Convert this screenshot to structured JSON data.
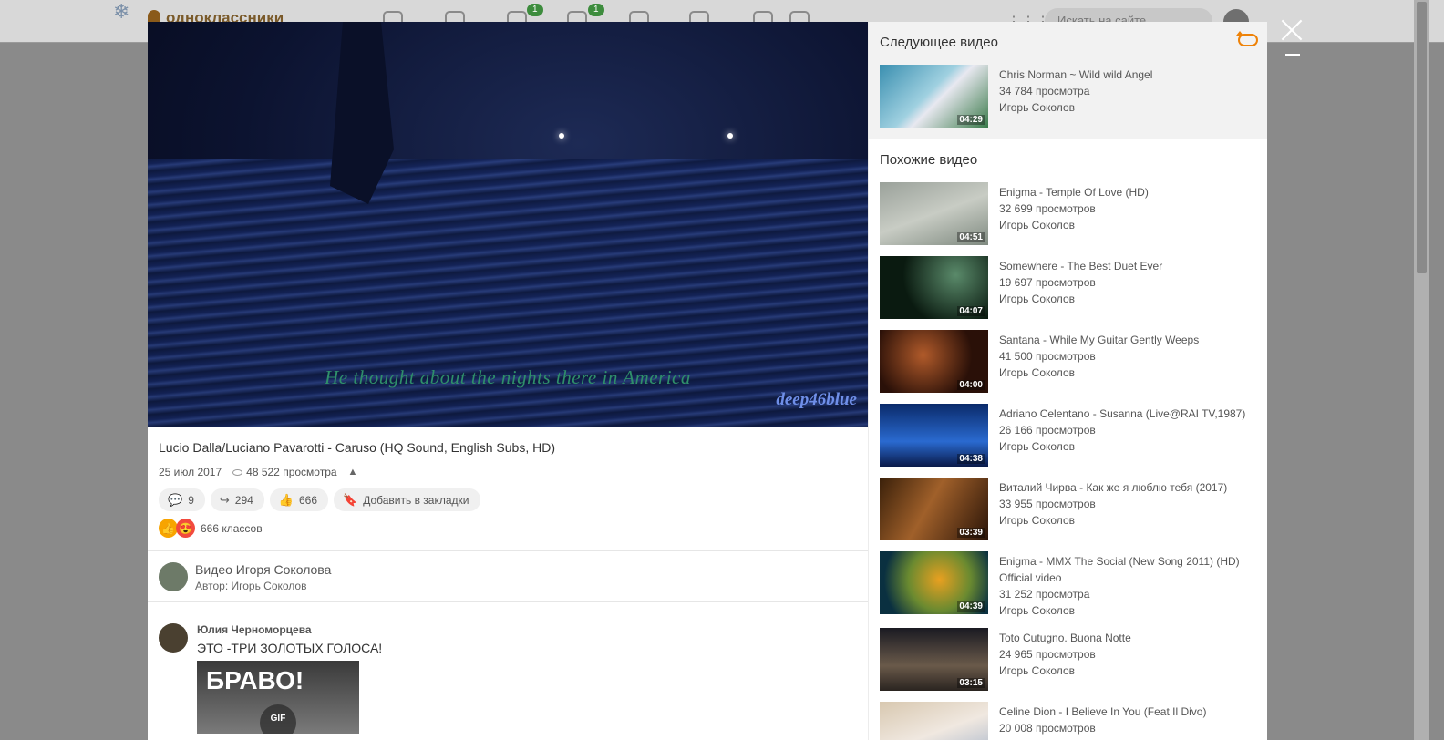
{
  "site": {
    "logo_text": "одноклассники",
    "search_placeholder": "Искать на сайте",
    "badges": [
      "1",
      "1"
    ]
  },
  "video": {
    "title": "Lucio Dalla/Luciano Pavarotti - Caruso (HQ Sound, English Subs, HD)",
    "subtitle_text": "He thought about the nights there in America",
    "watermark": "deep46blue",
    "date": "25 июл 2017",
    "views": "48 522 просмотра",
    "comments_count": "9",
    "shares_count": "294",
    "likes_count": "666",
    "bookmark_label": "Добавить в закладки",
    "classes_label": "666 классов"
  },
  "channel": {
    "name": "Видео Игоря Соколова",
    "author": "Автор: Игорь Соколов"
  },
  "comment": {
    "author": "Юлия Черноморцева",
    "text": "ЭТО -ТРИ   ЗОЛОТЫХ ГОЛОСА!",
    "gif_text": "БРАВО!",
    "gif_tag": "GIF"
  },
  "next": {
    "heading": "Следующее видео",
    "item": {
      "title": "Chris Norman ~ Wild wild Angel",
      "views": "34 784 просмотра",
      "author": "Игорь Соколов",
      "duration": "04:29"
    }
  },
  "similar": {
    "heading": "Похожие видео",
    "items": [
      {
        "title": "Enigma - Temple Of Love (HD)",
        "extra": "",
        "views": "32 699 просмотров",
        "author": "Игорь Соколов",
        "duration": "04:51"
      },
      {
        "title": "Somewhere - The Best Duet Ever",
        "extra": "",
        "views": "19 697 просмотров",
        "author": "Игорь Соколов",
        "duration": "04:07"
      },
      {
        "title": "Santana - While My Guitar Gently Weeps",
        "extra": "",
        "views": "41 500 просмотров",
        "author": "Игорь Соколов",
        "duration": "04:00"
      },
      {
        "title": "Adriano Celentano - Susanna (Live@RAI TV,1987)",
        "extra": "",
        "views": "26 166 просмотров",
        "author": "Игорь Соколов",
        "duration": "04:38"
      },
      {
        "title": "Виталий Чирва - Как же я люблю тебя (2017)",
        "extra": "",
        "views": "33 955 просмотров",
        "author": "Игорь Соколов",
        "duration": "03:39"
      },
      {
        "title": "Enigma - MMX The Social (New Song 2011) (HD)",
        "extra": "Official video",
        "views": "31 252 просмотра",
        "author": "Игорь Соколов",
        "duration": "04:39"
      },
      {
        "title": "Toto Cutugno. Buona Notte",
        "extra": "",
        "views": "24 965 просмотров",
        "author": "Игорь Соколов",
        "duration": "03:15"
      },
      {
        "title": "Celine Dion - I Believe In You (Feat Il Divo)",
        "extra": "",
        "views": "20 008 просмотров",
        "author": "",
        "duration": ""
      }
    ]
  }
}
